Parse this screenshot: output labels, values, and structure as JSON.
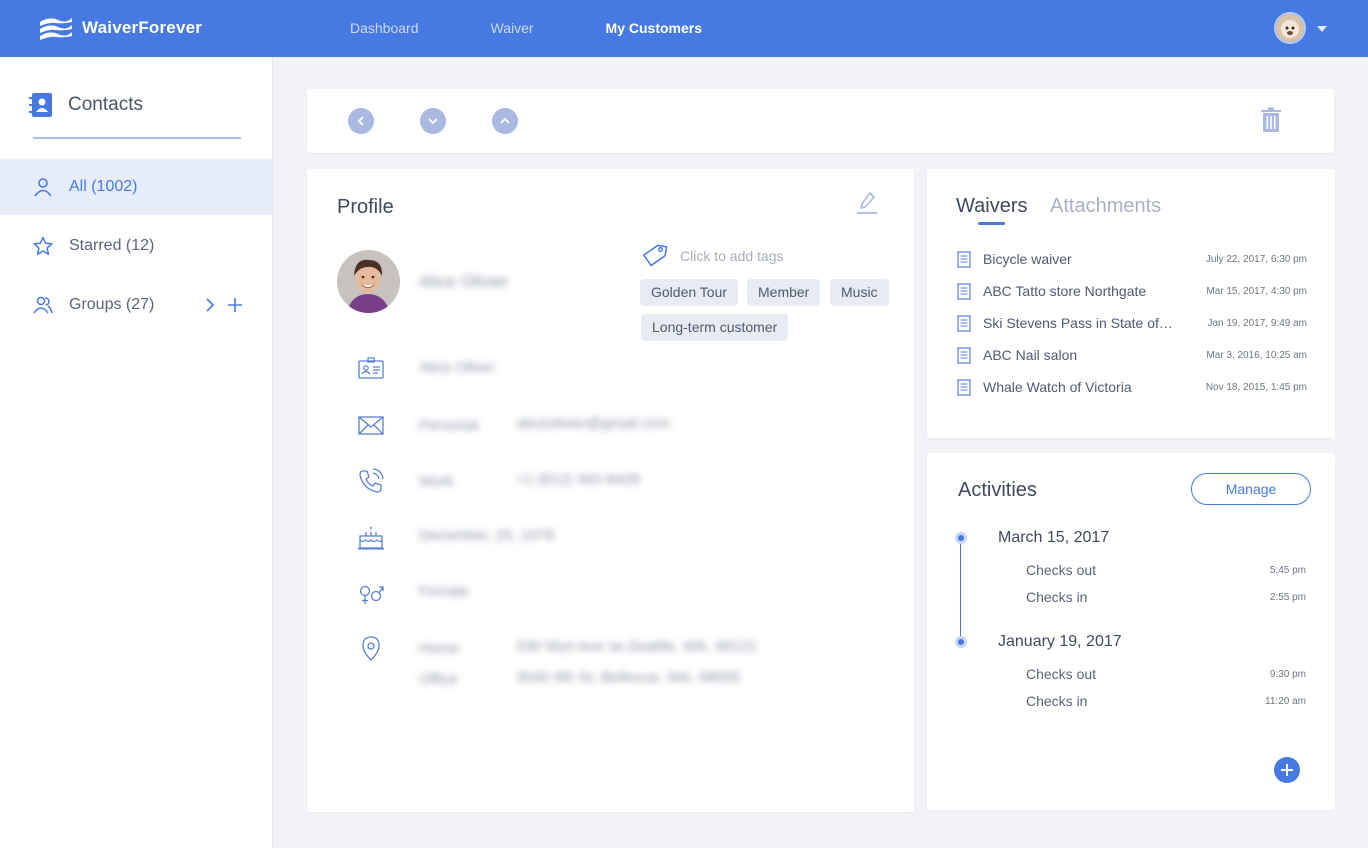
{
  "app": {
    "name": "WaiverForever",
    "nav": [
      "Dashboard",
      "Waiver",
      "My Customers"
    ]
  },
  "sidebar": {
    "title": "Contacts",
    "items": [
      {
        "label": "All (1002)",
        "icon": "user-icon"
      },
      {
        "label": "Starred (12)",
        "icon": "star-icon"
      },
      {
        "label": "Groups (27)",
        "icon": "users-icon"
      }
    ]
  },
  "profile": {
    "title": "Profile",
    "name": "Alice Olivier",
    "display_name": "Alice Oliver",
    "tags_hint": "Click to add tags",
    "tags": [
      "Golden Tour",
      "Member",
      "Music",
      "Long-term customer"
    ],
    "email": {
      "label": "Personal",
      "value": "aliceolivier@gmail.com"
    },
    "phone": {
      "label": "Work",
      "value": "+1 (812) 492-8428"
    },
    "birthday": "December, 25, 1978",
    "gender": "Female",
    "addresses": [
      {
        "label": "Home",
        "value": "330 Wyn Ave se,Seattle, WA, 98121"
      },
      {
        "label": "Office",
        "value": "3540 9th St, Bellevue, WA, 98005"
      }
    ]
  },
  "waivers": {
    "tabs": [
      "Waivers",
      "Attachments"
    ],
    "items": [
      {
        "name": "Bicycle waiver",
        "date": "July 22, 2017, 6:30 pm"
      },
      {
        "name": "ABC Tatto store Northgate",
        "date": "Mar 15, 2017, 4:30 pm"
      },
      {
        "name": "Ski Stevens Pass in State of…",
        "date": "Jan 19, 2017, 9:49 am"
      },
      {
        "name": "ABC Nail salon",
        "date": "Mar 3, 2016, 10:25 am"
      },
      {
        "name": "Whale Watch of Victoria",
        "date": "Nov 18, 2015, 1:45 pm"
      }
    ]
  },
  "activities": {
    "title": "Activities",
    "manage_label": "Manage",
    "groups": [
      {
        "date": "March 15, 2017",
        "events": [
          {
            "name": "Checks out",
            "time": "5:45 pm"
          },
          {
            "name": "Checks in",
            "time": "2:55 pm"
          }
        ]
      },
      {
        "date": "January 19, 2017",
        "events": [
          {
            "name": "Checks out",
            "time": "9:30 pm"
          },
          {
            "name": "Checks in",
            "time": "11:20 am"
          }
        ]
      }
    ]
  },
  "colors": {
    "brand": "#4679e2",
    "background": "#f1f3f7",
    "tag_bg": "#e7ebf3"
  }
}
